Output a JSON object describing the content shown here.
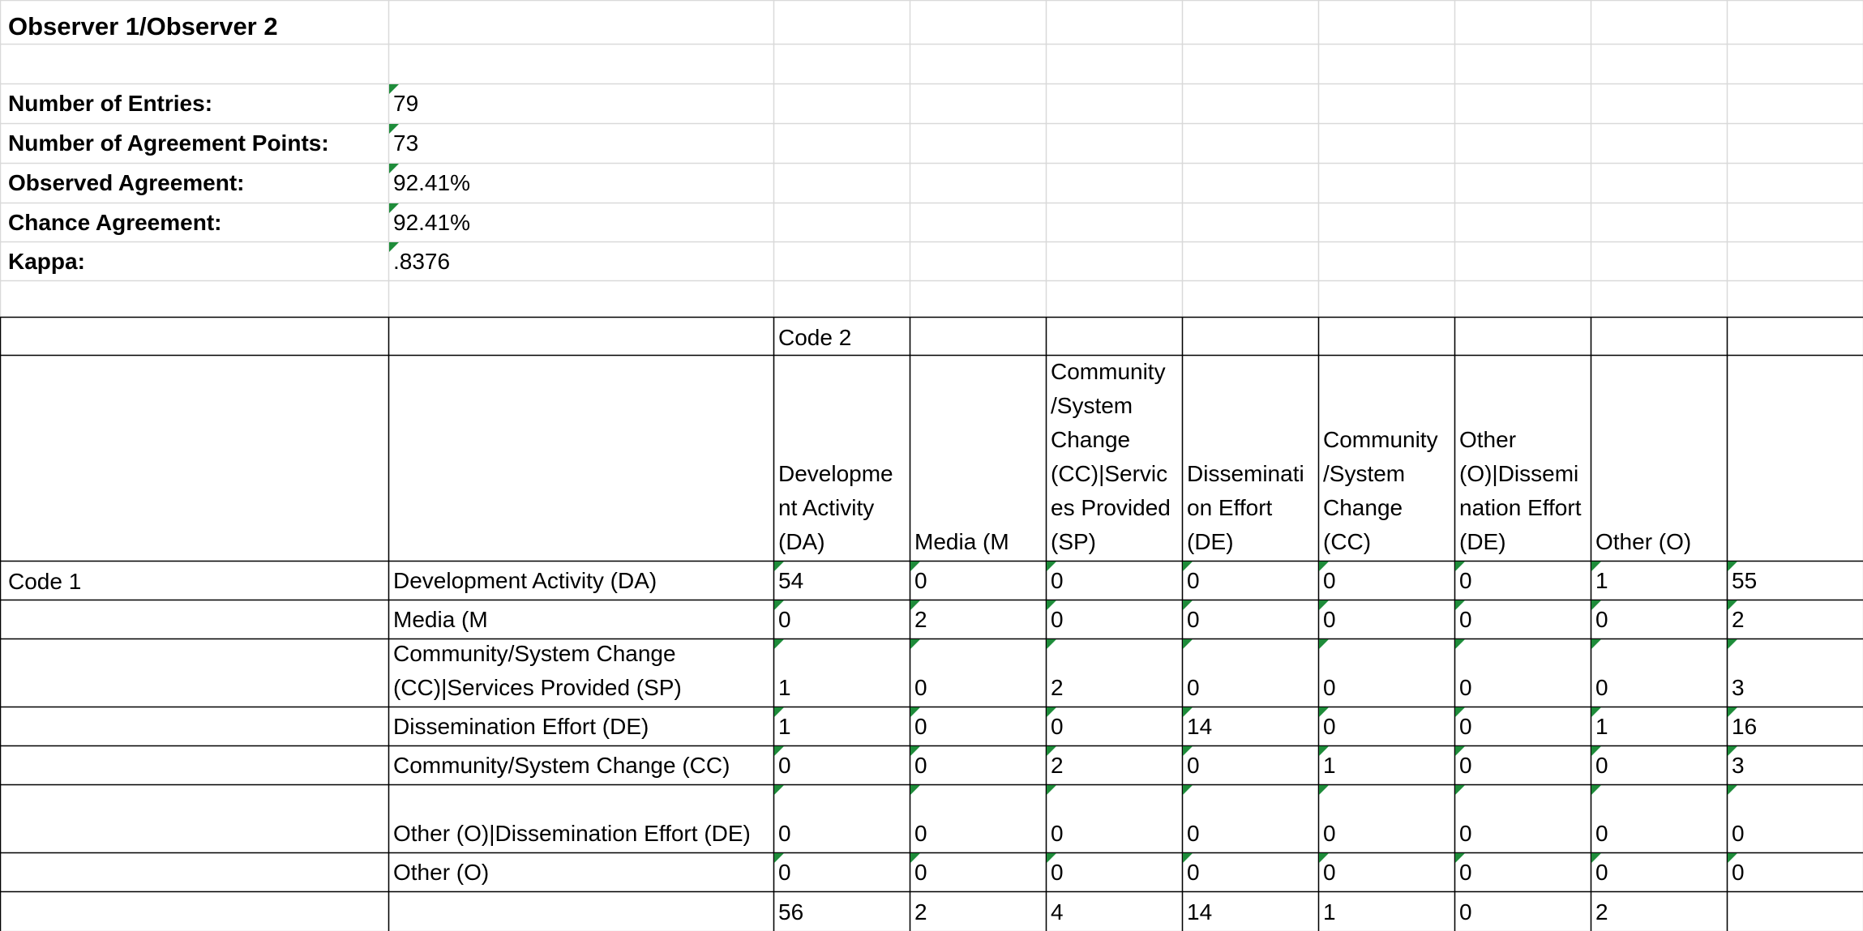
{
  "title": "Observer 1/Observer 2",
  "summary": [
    {
      "label": "Number of Entries:",
      "value": "79"
    },
    {
      "label": "Number of Agreement Points:",
      "value": "73"
    },
    {
      "label": "Observed Agreement:",
      "value": "92.41%"
    },
    {
      "label": "Chance Agreement:",
      "value": "92.41%"
    },
    {
      "label": "Kappa:",
      "value": ".8376"
    }
  ],
  "matrix": {
    "col_header_label": "Code 2",
    "row_header_label": "Code 1",
    "columns": [
      "Developme nt Activity (DA)",
      "Media (M",
      "Community /System Change (CC)|Servic es Provided (SP)",
      "Disseminati on Effort (DE)",
      "Community /System Change (CC)",
      "Other (O)|Dissemi nation Effort (DE)",
      "Other (O)",
      ""
    ],
    "rows": [
      {
        "label": "Development Activity (DA)",
        "values": [
          "54",
          "0",
          "0",
          "0",
          "0",
          "0",
          "1",
          "55"
        ]
      },
      {
        "label": "Media (M",
        "values": [
          "0",
          "2",
          "0",
          "0",
          "0",
          "0",
          "0",
          "2"
        ]
      },
      {
        "label": "Community/System Change (CC)|Services Provided (SP)",
        "values": [
          "1",
          "0",
          "2",
          "0",
          "0",
          "0",
          "0",
          "3"
        ]
      },
      {
        "label": "Dissemination Effort (DE)",
        "values": [
          "1",
          "0",
          "0",
          "14",
          "0",
          "0",
          "1",
          "16"
        ]
      },
      {
        "label": "Community/System Change (CC)",
        "values": [
          "0",
          "0",
          "2",
          "0",
          "1",
          "0",
          "0",
          "3"
        ]
      },
      {
        "label": "Other (O)|Dissemination Effort (DE)",
        "values": [
          "0",
          "0",
          "0",
          "0",
          "0",
          "0",
          "0",
          "0"
        ]
      },
      {
        "label": "Other (O)",
        "values": [
          "0",
          "0",
          "0",
          "0",
          "0",
          "0",
          "0",
          "0"
        ]
      }
    ],
    "totals": [
      "56",
      "2",
      "4",
      "14",
      "1",
      "0",
      "2",
      ""
    ]
  },
  "colors": {
    "gridline": "#d9d9d9",
    "border": "#000000",
    "error_indicator": "#1e8c3a"
  }
}
